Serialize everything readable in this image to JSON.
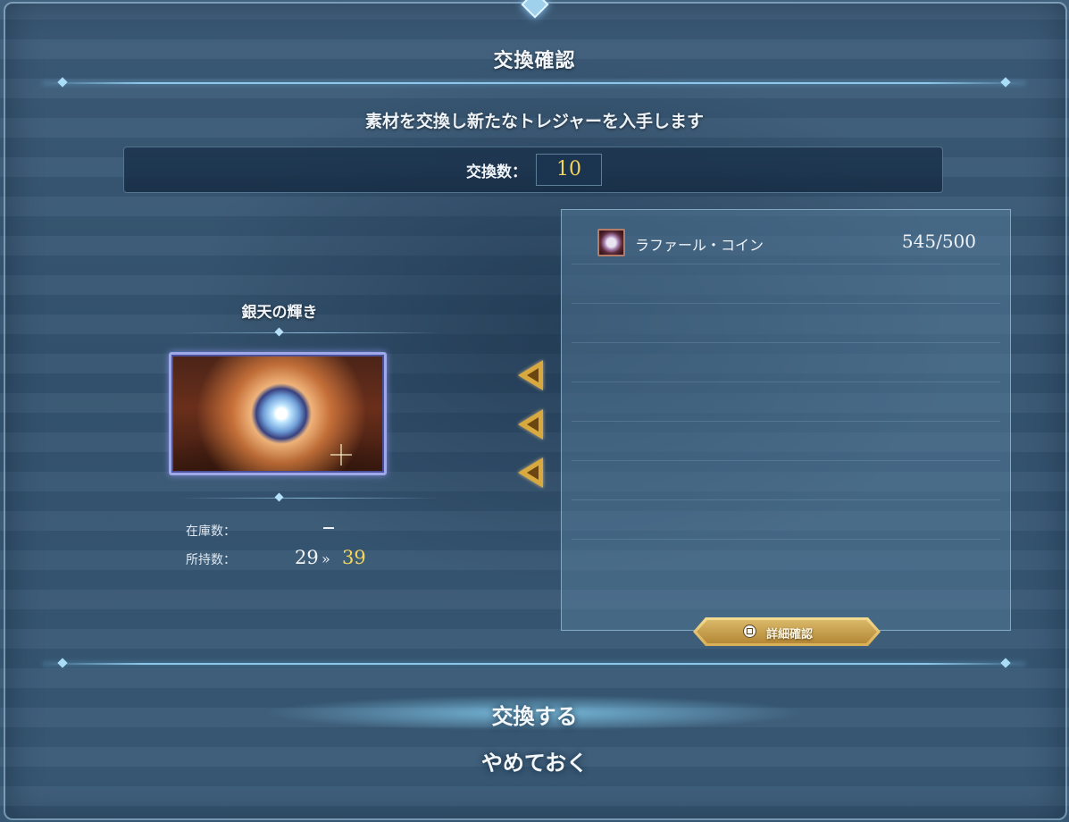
{
  "dialog": {
    "title": "交換確認",
    "message": "素材を交換し新たなトレジャーを入手します"
  },
  "exchange_count": {
    "label": "交換数：",
    "value": "10"
  },
  "item": {
    "name": "銀天の輝き",
    "image_icon": "silver-orb-treasure-icon",
    "stock_label": "在庫数：",
    "stock_value": "ー",
    "owned_label": "所持数：",
    "owned_before": "29",
    "owned_after": "39"
  },
  "materials": [
    {
      "icon": "raphael-coin-icon",
      "name": "ラファール・コイン",
      "quantity": "545/500"
    }
  ],
  "detail_button": {
    "label": "詳細確認",
    "glyph": "square-button-icon"
  },
  "actions": {
    "confirm": "交換する",
    "cancel": "やめておく"
  },
  "colors": {
    "accent_gold": "#f5d65a",
    "panel_border": "#aad2eb",
    "button_gold": "#d8ae55"
  }
}
